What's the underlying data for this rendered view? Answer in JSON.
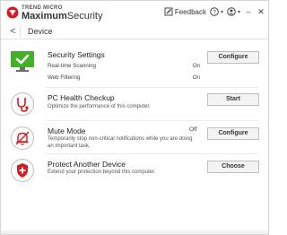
{
  "app": {
    "brand_top": "TREND MICRO",
    "brand_name_bold": "Maximum",
    "brand_name_rest": "Security",
    "feedback_label": "Feedback",
    "help_icon": "question-circle-icon",
    "account_icon": "user-icon",
    "minimize_glyph": "–",
    "close_glyph": "✕"
  },
  "subheader": {
    "back_glyph": "<",
    "title": "Device"
  },
  "rows": [
    {
      "title": "Security Settings",
      "items": [
        {
          "label": "Real-time Scanning",
          "value": "On"
        },
        {
          "label": "Web Filtering",
          "value": "On"
        }
      ],
      "button": "Configure",
      "icon": "monitor-check-icon"
    },
    {
      "title": "PC Health Checkup",
      "subtitle": "Optimize the performance of this computer.",
      "button": "Start",
      "icon": "stethoscope-icon"
    },
    {
      "title": "Mute Mode",
      "status": "Off",
      "subtitle_line1": "Temporarily stop non-critical notifications while you are doing",
      "subtitle_line2": "an important task.",
      "button": "Configure",
      "icon": "mute-bell-icon"
    },
    {
      "title": "Protect Another Device",
      "subtitle": "Extend your protection beyond this computer.",
      "button": "Choose",
      "icon": "shield-plus-icon"
    }
  ],
  "colors": {
    "brand_red": "#d71920",
    "green": "#43b02a",
    "button_bg": "#f3f3f3"
  }
}
